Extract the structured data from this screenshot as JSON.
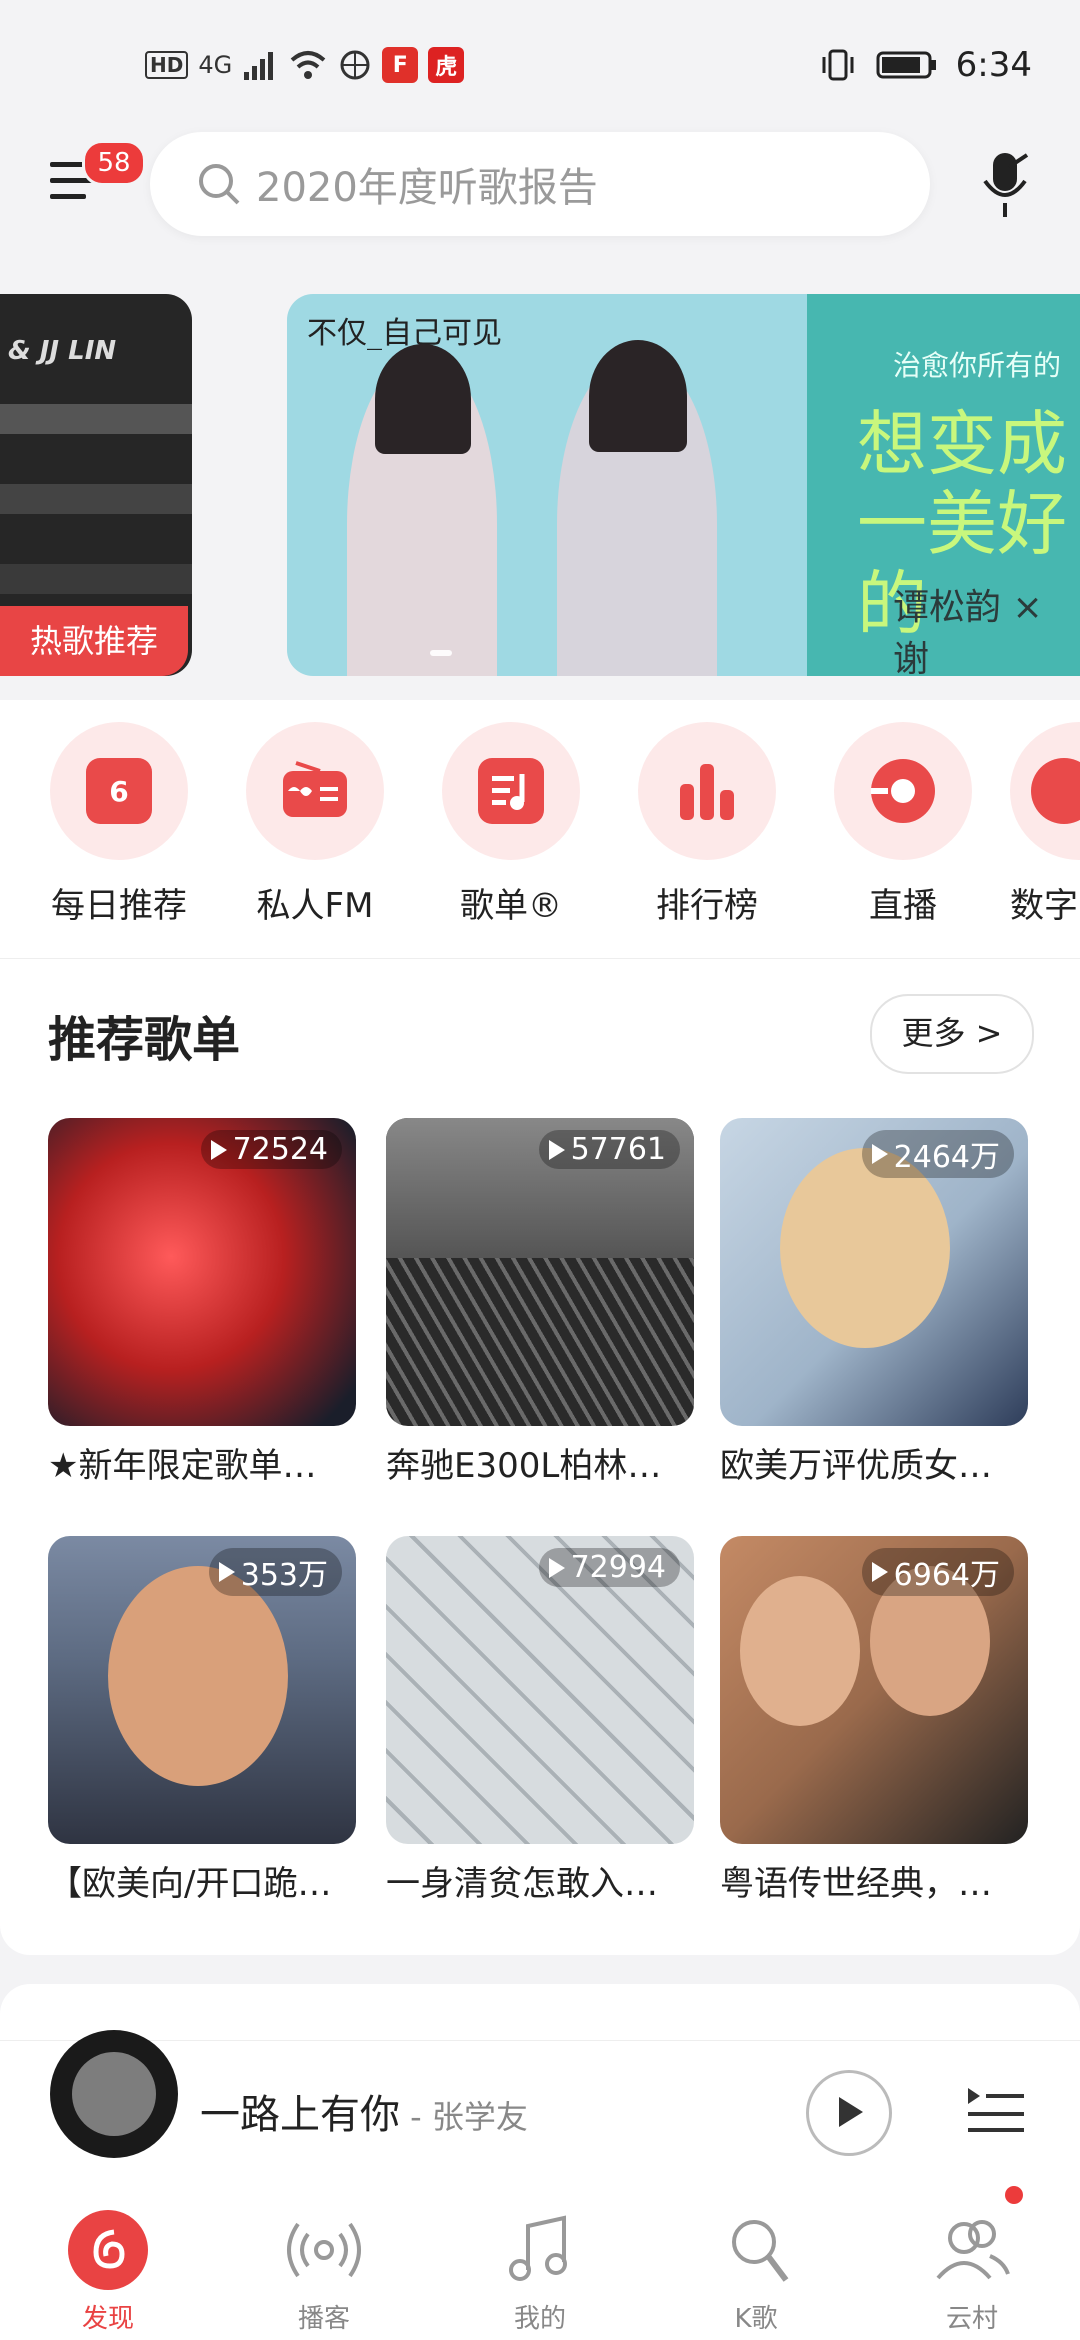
{
  "status_bar": {
    "time": "6:34",
    "hd": "HD",
    "net": "4G",
    "app1": "F",
    "app2": "虎"
  },
  "header": {
    "badge_count": "58",
    "search_placeholder": "2020年度听歌报告"
  },
  "banner": {
    "left_label": "& JJ LIN",
    "left_tag": "热歌推荐",
    "brand": "不仅_自己可见",
    "caption_top": "治愈你所有的",
    "caption_script": "想变成一美好的",
    "caption_names": "谭松韵 × 谢"
  },
  "quick_entries": [
    {
      "label": "每日推荐",
      "icon": "calendar-icon",
      "icon_text": "6"
    },
    {
      "label": "私人FM",
      "icon": "radio-icon",
      "icon_text": ""
    },
    {
      "label": "歌单®",
      "icon": "playlist-icon",
      "icon_text": ""
    },
    {
      "label": "排行榜",
      "icon": "chart-bars-icon",
      "icon_text": ""
    },
    {
      "label": "直播",
      "icon": "live-icon",
      "icon_text": ""
    },
    {
      "label": "数字",
      "icon": "digital-icon",
      "icon_text": ""
    }
  ],
  "recommend": {
    "title": "推荐歌单",
    "more": "更多 >",
    "cards": [
      {
        "count": "72524",
        "title": "★新年限定歌单…"
      },
      {
        "count": "57761",
        "title": "奔驰E300L柏林之…"
      },
      {
        "count": "2464万",
        "title": "欧美万评优质女…"
      },
      {
        "count": "353万",
        "title": "【欧美向/开口跪…"
      },
      {
        "count": "72994",
        "title": "一身清贫怎敢入…"
      },
      {
        "count": "6964万",
        "title": "粤语传世经典，…"
      }
    ],
    "cover_colors": [
      "#c62a2a",
      "#4a4a4a",
      "#9bb7cf",
      "#6d5a4e",
      "#c9cfd2",
      "#b07c5a"
    ]
  },
  "player": {
    "song": "一路上有你",
    "artist": " - 张学友"
  },
  "tabs": [
    {
      "label": "发现",
      "icon": "discover-icon",
      "active": true
    },
    {
      "label": "播客",
      "icon": "podcast-icon",
      "active": false
    },
    {
      "label": "我的",
      "icon": "music-note-icon",
      "active": false
    },
    {
      "label": "K歌",
      "icon": "karaoke-mic-icon",
      "active": false
    },
    {
      "label": "云村",
      "icon": "community-icon",
      "active": false
    }
  ],
  "colors": {
    "accent": "#e94343",
    "background": "#f3f3f5"
  }
}
